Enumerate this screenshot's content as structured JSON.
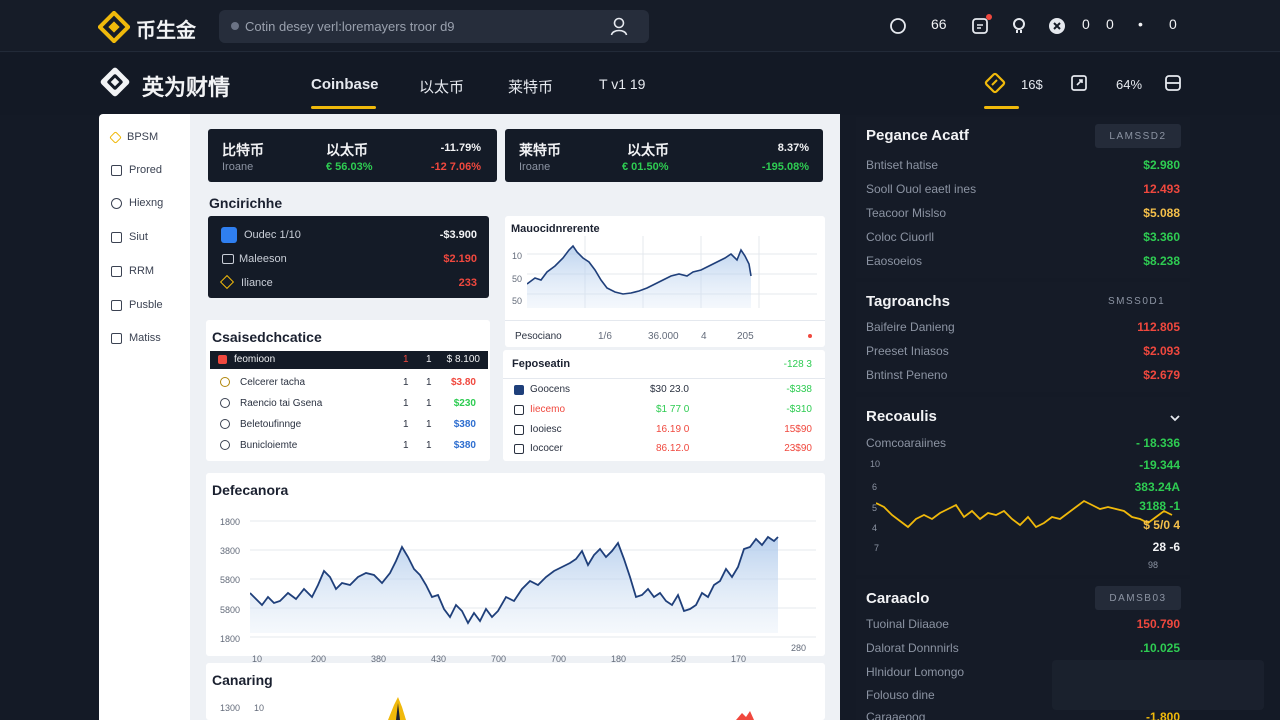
{
  "top": {
    "logo_text": "币生金",
    "search_placeholder": "Cotin desey verl:loremayers troor d9",
    "right_numbers": [
      "66",
      "0",
      "0",
      "0"
    ],
    "colors": {
      "accent": "#f0b90b",
      "up": "#2ecc52",
      "down": "#f0483e",
      "warn": "#f5c04a"
    }
  },
  "nav": {
    "brand": "英为财情",
    "tabs": [
      "Coinbase",
      "以太币",
      "莱特币",
      "T v1 19"
    ],
    "right_text": [
      "16$",
      "64%"
    ]
  },
  "sidebar": {
    "items": [
      "BPSM",
      "Prored",
      "Hiexng",
      "Siut",
      "RRM",
      "Pusble",
      "Matiss"
    ]
  },
  "tickers": [
    {
      "name": "比特币",
      "sub": "Iroane",
      "pair": "以太币",
      "pair_change": "€ 56.03%",
      "change": "-11.79%",
      "change2": "-12 7.06%"
    },
    {
      "name": "莱特币",
      "sub": "Iroane",
      "pair": "以太币",
      "pair_change": "€ 01.50%",
      "change": "8.37%",
      "change2": "-195.08%"
    }
  ],
  "overview": {
    "title": "Gncirichhe",
    "rows": [
      {
        "label": "Oudec 1/10",
        "value": "-$3.900"
      },
      {
        "label": "Maleeson",
        "value": "$2.190"
      },
      {
        "label": "Iliance",
        "value": "233"
      }
    ]
  },
  "mini_chart": {
    "title": "Mauocidnrerente",
    "yticks": [
      "10",
      "50",
      "50"
    ],
    "footer": [
      "Pesociano",
      "1/6",
      "36.000",
      "4",
      "205"
    ]
  },
  "table1": {
    "title": "Csaisedchcatice",
    "header": [
      "feomioon",
      "1",
      "1",
      "$ 8.100"
    ],
    "rows": [
      {
        "name": "Celcerer tacha",
        "a": "1",
        "b": "1",
        "value": "$3.80"
      },
      {
        "name": "Raencio tai  Gsena",
        "a": "1",
        "b": "1",
        "value": "$230"
      },
      {
        "name": "Beletoufinnge",
        "a": "1",
        "b": "1",
        "value": "$380"
      },
      {
        "name": "Bunicloiemte",
        "a": "1",
        "b": "1",
        "value": "$380"
      }
    ]
  },
  "table2": {
    "title": "Feposeatin",
    "title_value": "-128 3",
    "rows": [
      {
        "name": "Goocens",
        "v1": "$30 23.0",
        "v2": "-$338"
      },
      {
        "name": "Iiecemo",
        "v1": "$1 77 0",
        "v2": "-$310"
      },
      {
        "name": "Iooiesc",
        "v1": "16.19 0",
        "v2": "15$90"
      },
      {
        "name": "Iococer",
        "v1": "86.12.0",
        "v2": "23$90"
      }
    ]
  },
  "big_chart": {
    "title": "Defecanora",
    "yticks": [
      "1800",
      "3800",
      "5800",
      "5800",
      "1800"
    ],
    "xticks": [
      "10",
      "200",
      "380",
      "430",
      "700",
      "700",
      "180",
      "250",
      "170",
      "280"
    ]
  },
  "bottom_chart": {
    "title": "Canaring",
    "ytick": "1300",
    "ytick2": "10"
  },
  "right": {
    "section1": {
      "title": "Pegance Acatf",
      "badge": "LAMSSD2",
      "rows": [
        {
          "label": "Bntiset hatise",
          "value": "$2.980"
        },
        {
          "label": "Sooll Ouol eaetl ines",
          "value": "12.493"
        },
        {
          "label": "Teacoor Mislso",
          "value": "$5.088"
        },
        {
          "label": "Coloc Ciuorll",
          "value": "$3.360"
        },
        {
          "label": "Eaosoeios",
          "value": "$8.238"
        }
      ]
    },
    "section2": {
      "title": "Tagroanchs",
      "badge": "SMSS0D1",
      "rows": [
        {
          "label": "Baifeire Danieng",
          "value": "112.805"
        },
        {
          "label": "Preeset Iniasos",
          "value": "$2.093"
        },
        {
          "label": "Bntinst Peneno",
          "value": "$2.679"
        }
      ]
    },
    "section3": {
      "title": "Recoaulis",
      "first_label": "Comcoaraiines",
      "first_value": "- 18.336",
      "yticks": [
        "10",
        "6",
        "5",
        "4",
        "7"
      ],
      "values": [
        "-19.344",
        "383.24A",
        "3188 -1",
        "$ 5/0  4",
        "28 -6"
      ],
      "bottom": "98"
    },
    "section4": {
      "title": "Caraaclo",
      "badge": "DAMSB03",
      "rows": [
        {
          "label": "Tuoinal Diiaaoe",
          "value": "150.790"
        },
        {
          "label": "Dalorat Donnnirls",
          "value": ".10.025"
        },
        {
          "label": "Hlnidour Lomongo",
          "value": ""
        },
        {
          "label": "Folouso dine",
          "value": ""
        },
        {
          "label": "Caraaeoog",
          "value": "-1.800"
        }
      ]
    }
  }
}
